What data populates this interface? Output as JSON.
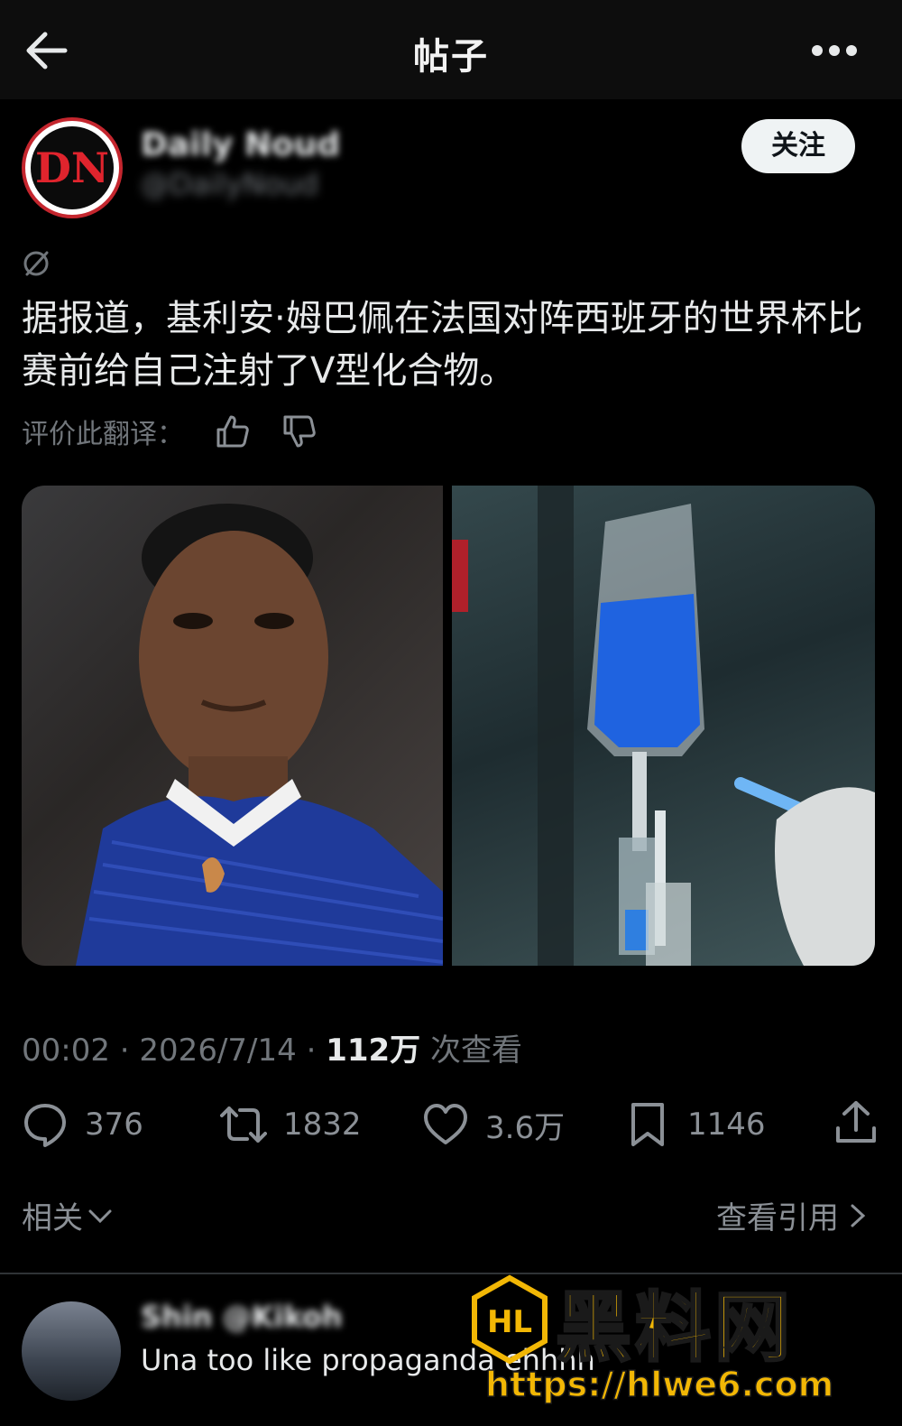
{
  "header": {
    "title": "帖子"
  },
  "author": {
    "display_name": "Daily Noud",
    "handle": "@DailyNoud",
    "follow_label": "关注",
    "avatar_text": "DN"
  },
  "post": {
    "text": "据报道，基利安·姆巴佩在法国对阵西班牙的世界杯比赛前给自己注射了V型化合物。",
    "rate_translation_label": "评价此翻译："
  },
  "meta": {
    "time": "00:02",
    "date": "2026/7/14",
    "views": "112万",
    "views_label": "次查看",
    "separator": "·"
  },
  "actions": {
    "replies": "376",
    "reposts": "1832",
    "likes": "3.6万",
    "bookmarks": "1146"
  },
  "related": {
    "label": "相关",
    "quotes_label": "查看引用"
  },
  "reply": {
    "name": "Shin @Kikoh",
    "text": "Una too like propaganda ehhhh"
  },
  "watermark": {
    "title": "黑料网",
    "url": "https://hlwe6.com",
    "logo_text": "HL"
  },
  "colors": {
    "background": "#000000",
    "accent_red": "#c4262e",
    "watermark_yellow": "#f2b705",
    "muted_text": "#71767b"
  }
}
